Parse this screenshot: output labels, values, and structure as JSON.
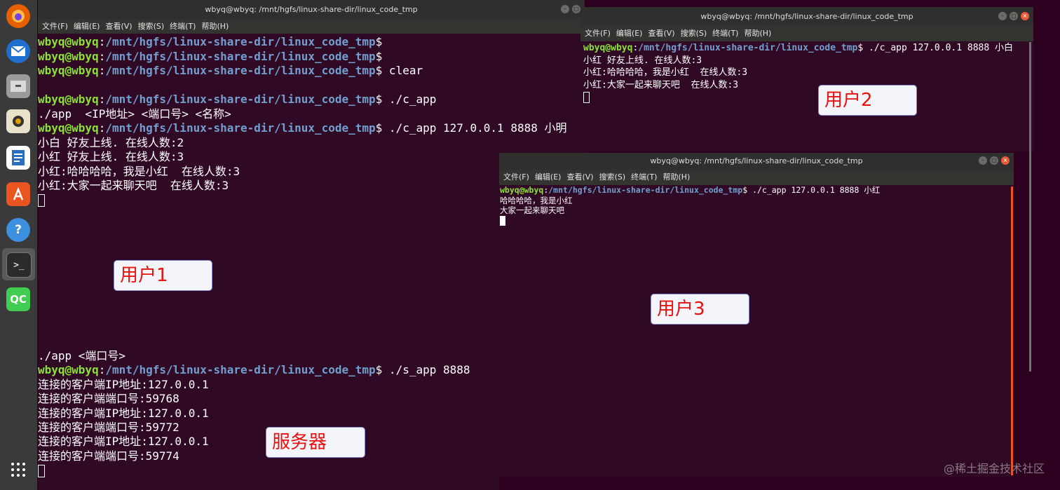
{
  "dock": {
    "icons": [
      "firefox-icon",
      "thunderbird-icon",
      "files-icon",
      "rhythmbox-icon",
      "libreoffice-writer-icon",
      "software-center-icon",
      "help-icon",
      "terminal-icon",
      "qt-creator-icon",
      "show-apps-icon"
    ],
    "help_glyph": "?",
    "qt_label": "QC",
    "terminal_glyph": ">_"
  },
  "window1": {
    "title": "wbyq@wbyq: /mnt/hgfs/linux-share-dir/linux_code_tmp",
    "menu": [
      "文件(F)",
      "编辑(E)",
      "查看(V)",
      "搜索(S)",
      "终端(T)",
      "帮助(H)"
    ],
    "user": "wbyq@wbyq",
    "path": "/mnt/hgfs/linux-share-dir/linux_code_tmp",
    "lines": [
      {
        "prompt": true,
        "cmd": ""
      },
      {
        "prompt": true,
        "cmd": ""
      },
      {
        "prompt": true,
        "cmd": " clear"
      },
      {
        "text": ""
      },
      {
        "prompt": true,
        "cmd": " ./c_app"
      },
      {
        "text": "./app  <IP地址> <端口号> <名称>"
      },
      {
        "prompt": true,
        "cmd": " ./c_app 127.0.0.1 8888 小明"
      },
      {
        "text": "小白 好友上线. 在线人数:2"
      },
      {
        "text": "小红 好友上线. 在线人数:3"
      },
      {
        "text": "小红:哈哈哈哈，我是小红  在线人数:3"
      },
      {
        "text": "小红:大家一起来聊天吧  在线人数:3"
      }
    ]
  },
  "window_server": {
    "lines": [
      {
        "text": "./app <端口号>"
      },
      {
        "prompt": true,
        "cmd": " ./s_app 8888"
      },
      {
        "text": "连接的客户端IP地址:127.0.0.1"
      },
      {
        "text": "连接的客户端端口号:59768"
      },
      {
        "text": "连接的客户端IP地址:127.0.0.1"
      },
      {
        "text": "连接的客户端端口号:59772"
      },
      {
        "text": "连接的客户端IP地址:127.0.0.1"
      },
      {
        "text": "连接的客户端端口号:59774"
      }
    ]
  },
  "window2": {
    "title": "wbyq@wbyq: /mnt/hgfs/linux-share-dir/linux_code_tmp",
    "menu": [
      "文件(F)",
      "编辑(E)",
      "查看(V)",
      "搜索(S)",
      "终端(T)",
      "帮助(H)"
    ],
    "lines": [
      {
        "prompt": true,
        "cmd": " ./c_app 127.0.0.1 8888 小白"
      },
      {
        "text": "小红 好友上线. 在线人数:3"
      },
      {
        "text": "小红:哈哈哈哈，我是小红  在线人数:3"
      },
      {
        "text": "小红:大家一起来聊天吧  在线人数:3"
      }
    ]
  },
  "window3": {
    "title": "wbyq@wbyq: /mnt/hgfs/linux-share-dir/linux_code_tmp",
    "menu": [
      "文件(F)",
      "编辑(E)",
      "查看(V)",
      "搜索(S)",
      "终端(T)",
      "帮助(H)"
    ],
    "lines": [
      {
        "prompt": true,
        "cmd": " ./c_app 127.0.0.1 8888 小红"
      },
      {
        "text": "哈哈哈哈，我是小红"
      },
      {
        "text": "大家一起来聊天吧"
      }
    ]
  },
  "labels": {
    "user1": "用户1",
    "user2": "用户2",
    "user3": "用户3",
    "server": "服务器"
  },
  "watermark": "@稀土掘金技术社区",
  "colors": {
    "terminal_bg": "#300a24",
    "prompt_user": "#8ae234",
    "prompt_path": "#729fcf",
    "label_text": "#e8120f",
    "close_button": "#e65c3b"
  }
}
